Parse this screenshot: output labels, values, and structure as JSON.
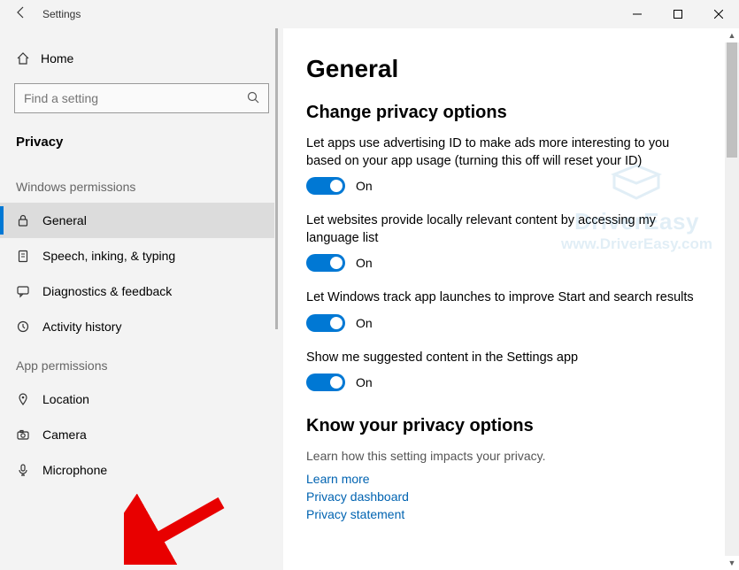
{
  "window": {
    "title": "Settings"
  },
  "sidebar": {
    "home": "Home",
    "search_placeholder": "Find a setting",
    "header": "Privacy",
    "section1_title": "Windows permissions",
    "win_items": [
      {
        "label": "General"
      },
      {
        "label": "Speech, inking, & typing"
      },
      {
        "label": "Diagnostics & feedback"
      },
      {
        "label": "Activity history"
      }
    ],
    "section2_title": "App permissions",
    "app_items": [
      {
        "label": "Location"
      },
      {
        "label": "Camera"
      },
      {
        "label": "Microphone"
      }
    ]
  },
  "main": {
    "title": "General",
    "section_title": "Change privacy options",
    "opts": [
      {
        "desc": "Let apps use advertising ID to make ads more interesting to you based on your app usage (turning this off will reset your ID)",
        "state": "On"
      },
      {
        "desc": "Let websites provide locally relevant content by accessing my language list",
        "state": "On"
      },
      {
        "desc": "Let Windows track app launches to improve Start and search results",
        "state": "On"
      },
      {
        "desc": "Show me suggested content in the Settings app",
        "state": "On"
      }
    ],
    "know_title": "Know your privacy options",
    "know_desc": "Learn how this setting impacts your privacy.",
    "links": [
      "Learn more",
      "Privacy dashboard",
      "Privacy statement"
    ]
  },
  "watermark": {
    "brand": "DriverEasy",
    "url": "www.DriverEasy.com"
  }
}
